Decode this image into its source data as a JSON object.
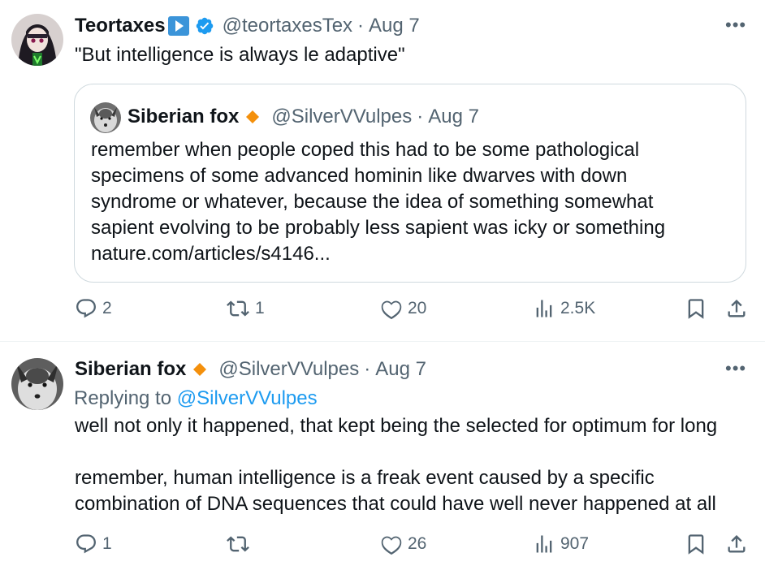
{
  "tweet1": {
    "display_name": "Teortaxes",
    "handle": "@teortaxesTex",
    "separator": "·",
    "date": "Aug 7",
    "text": "\"But intelligence is always le adaptive\"",
    "icons": {
      "play_badge": "play-badge-icon",
      "verified": "verified-badge-icon"
    },
    "quoted": {
      "display_name": "Siberian fox",
      "handle": "@SilverVVulpes",
      "separator": "·",
      "date": "Aug 7",
      "lines": [
        "remember when people coped this had to be some pathological",
        "specimens of some advanced hominin like dwarves with down",
        "syndrome or whatever, because the idea of something somewhat",
        "sapient evolving to be probably less sapient was icky or something",
        "nature.com/articles/s4146..."
      ]
    },
    "stats": {
      "replies": "2",
      "reposts": "1",
      "likes": "20",
      "views": "2.5K"
    }
  },
  "tweet2": {
    "display_name": "Siberian fox",
    "handle": "@SilverVVulpes",
    "separator": "·",
    "date": "Aug 7",
    "replying_label": "Replying to",
    "replying_to": "@SilverVVulpes",
    "lines": [
      "well not only it happened, that kept being the selected for optimum for long",
      "remember, human intelligence is a freak event caused by a specific",
      "combination of DNA sequences that could have well never happened at all"
    ],
    "stats": {
      "replies": "1",
      "reposts": "",
      "likes": "26",
      "views": "907"
    }
  },
  "colors": {
    "accent": "#1d9bf0",
    "secondary_text": "#536471",
    "border": "#cfd9de",
    "gold_badge": "#f4900c"
  }
}
